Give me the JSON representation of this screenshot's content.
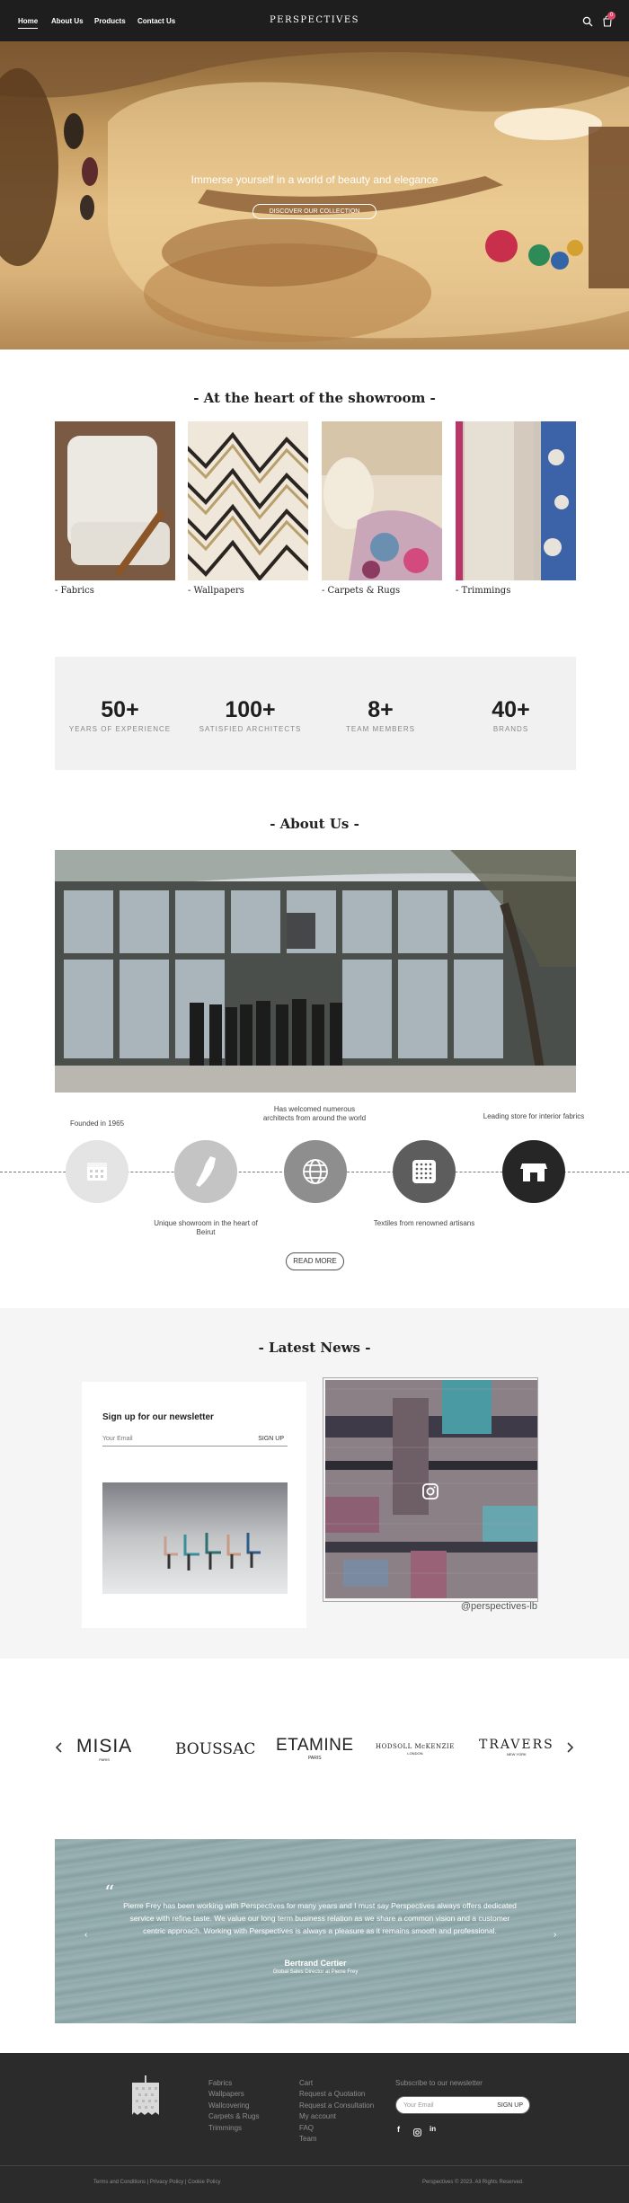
{
  "nav": {
    "items": [
      {
        "label": "Home"
      },
      {
        "label": "About Us"
      },
      {
        "label": "Products"
      },
      {
        "label": "Contact Us"
      }
    ],
    "logo": "PERSPECTIVES",
    "cart_count": "0"
  },
  "hero": {
    "headline": "Immerse yourself in a world of beauty and elegance",
    "cta": "DISCOVER OUR COLLECTION"
  },
  "showroom": {
    "title": "- At the heart of the showroom -",
    "categories": [
      {
        "label": "- Fabrics"
      },
      {
        "label": "- Wallpapers"
      },
      {
        "label": "- Carpets & Rugs"
      },
      {
        "label": "- Trimmings"
      }
    ]
  },
  "stats": [
    {
      "value": "50+",
      "label": "YEARS OF EXPERIENCE"
    },
    {
      "value": "100+",
      "label": "SATISFIED ARCHITECTS"
    },
    {
      "value": "8+",
      "label": "TEAM MEMBERS"
    },
    {
      "value": "40+",
      "label": "BRANDS"
    }
  ],
  "about": {
    "title": "- About Us -",
    "timeline_top": [
      "Founded in 1965",
      "Has welcomed numerous architects from around the world",
      "Leading store for interior fabrics"
    ],
    "timeline_bottom": [
      "Unique showroom in the heart of Beirut",
      "Textiles from renowned artisans"
    ],
    "read_more": "READ MORE"
  },
  "news": {
    "title": "- Latest News -",
    "newsletter_heading": "Sign up for our newsletter",
    "email_placeholder": "Your Email",
    "signup_label": "SIGN UP",
    "instagram_handle": "@perspectives-lb"
  },
  "brands": {
    "items": [
      {
        "name": "MISIA",
        "sub": "PARIS"
      },
      {
        "name": "BOUSSAC",
        "sub": ""
      },
      {
        "name": "ETAMINE",
        "sub": "PARIS"
      },
      {
        "name": "HODSOLL McKENZIE",
        "sub": "LONDON"
      },
      {
        "name": "TRAVERS",
        "sub": "NEW YORK"
      }
    ]
  },
  "testimonial": {
    "quote": "Pierre Frey has been working with Perspectives for many years and I must say Perspectives always offers dedicated service with refine taste. We value our long term business relation as we share a common vision and a customer centric approach. Working with Perspectives is always a pleasure as it remains smooth and professional.",
    "author": "Bertrand Certier",
    "role": "Global Sales Director at Pierre Frey"
  },
  "footer": {
    "col1": [
      "Fabrics",
      "Wallpapers",
      "Wallcovering",
      "Carpets & Rugs",
      "Trimmings"
    ],
    "col2": [
      "Cart",
      "Request a Quotation",
      "Request a Consultation",
      "My account",
      "FAQ",
      "Team"
    ],
    "newsletter_label": "Subscribe to our newsletter",
    "email_placeholder": "Your Email",
    "signup_label": "SIGN UP",
    "legal": "Terms and Conditions | Privacy Policy | Cookie Policy",
    "copyright": "Perspectives © 2023. All Rights Reserved."
  },
  "icons": [
    "search-icon",
    "cart-icon",
    "calendar-icon",
    "lebanon-map-icon",
    "globe-icon",
    "textile-icon",
    "store-icon",
    "instagram-icon",
    "quote-icon",
    "facebook-icon",
    "linkedin-icon",
    "chevron-left-icon",
    "chevron-right-icon"
  ]
}
